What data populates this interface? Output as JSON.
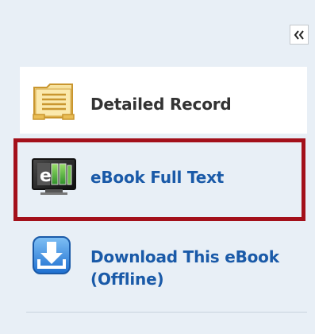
{
  "panel": {
    "collapse_button": {
      "icon": "double-chevron-left-icon"
    },
    "items": [
      {
        "label": "Detailed Record",
        "icon": "folder-document-icon"
      },
      {
        "label": "eBook Full Text",
        "icon": "ebook-monitor-icon"
      },
      {
        "label_line1": "Download This eBook",
        "label_line2": "(Offline)",
        "icon": "download-icon"
      }
    ]
  },
  "colors": {
    "panel_background": "#e8eff6",
    "link_blue": "#1a5aa8",
    "highlight_red": "#a3101a",
    "text_dark": "#333333"
  }
}
